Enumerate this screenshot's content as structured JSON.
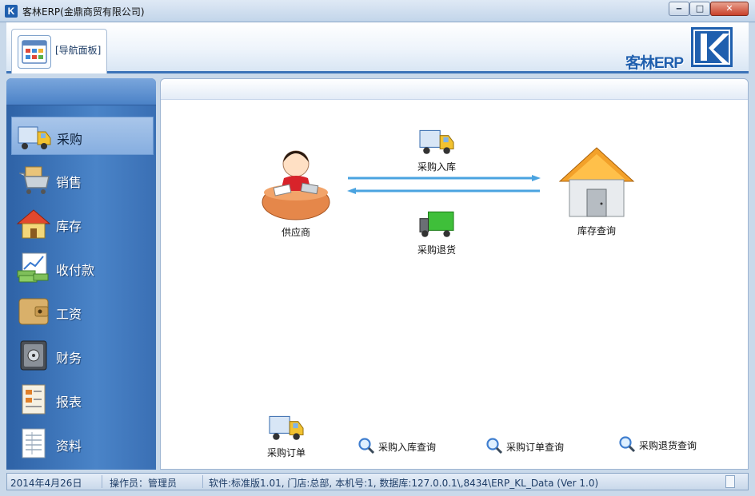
{
  "window": {
    "title": "客林ERP(金鼎商贸有限公司)",
    "logo_letter": "K",
    "controls": {
      "minimize": "‒",
      "maximize": "□",
      "close": "✕"
    }
  },
  "topbar": {
    "nav_tab_label": "[导航面板]",
    "brand_text": "客林ERP"
  },
  "sidebar": {
    "items": [
      {
        "label": "采购",
        "icon": "truck-icon",
        "active": true
      },
      {
        "label": "销售",
        "icon": "shopping-cart-icon",
        "active": false
      },
      {
        "label": "库存",
        "icon": "house-icon",
        "active": false
      },
      {
        "label": "收付款",
        "icon": "money-chart-icon",
        "active": false
      },
      {
        "label": "工资",
        "icon": "wallet-icon",
        "active": false
      },
      {
        "label": "财务",
        "icon": "safe-icon",
        "active": false
      },
      {
        "label": "报表",
        "icon": "report-icon",
        "active": false
      },
      {
        "label": "资料",
        "icon": "document-icon",
        "active": false
      }
    ]
  },
  "flow": {
    "supplier": "供应商",
    "warehouse": "库存查询",
    "purchase_in": "采购入库",
    "purchase_return": "采购退货",
    "purchase_order": "采购订单"
  },
  "queries": {
    "in_query": "采购入库查询",
    "order_query": "采购订单查询",
    "return_query": "采购退货查询"
  },
  "status": {
    "date": "2014年4月26日",
    "operator": "操作员：管理员",
    "info": "软件:标准版1.01, 门店:总部, 本机号:1,   数据库:127.0.0.1\\,8434\\ERP_KL_Data (Ver 1.0)"
  },
  "colors": {
    "sidebar": "#3a6fb4",
    "accent": "#1f5fae",
    "arrow": "#4aa3e0"
  }
}
